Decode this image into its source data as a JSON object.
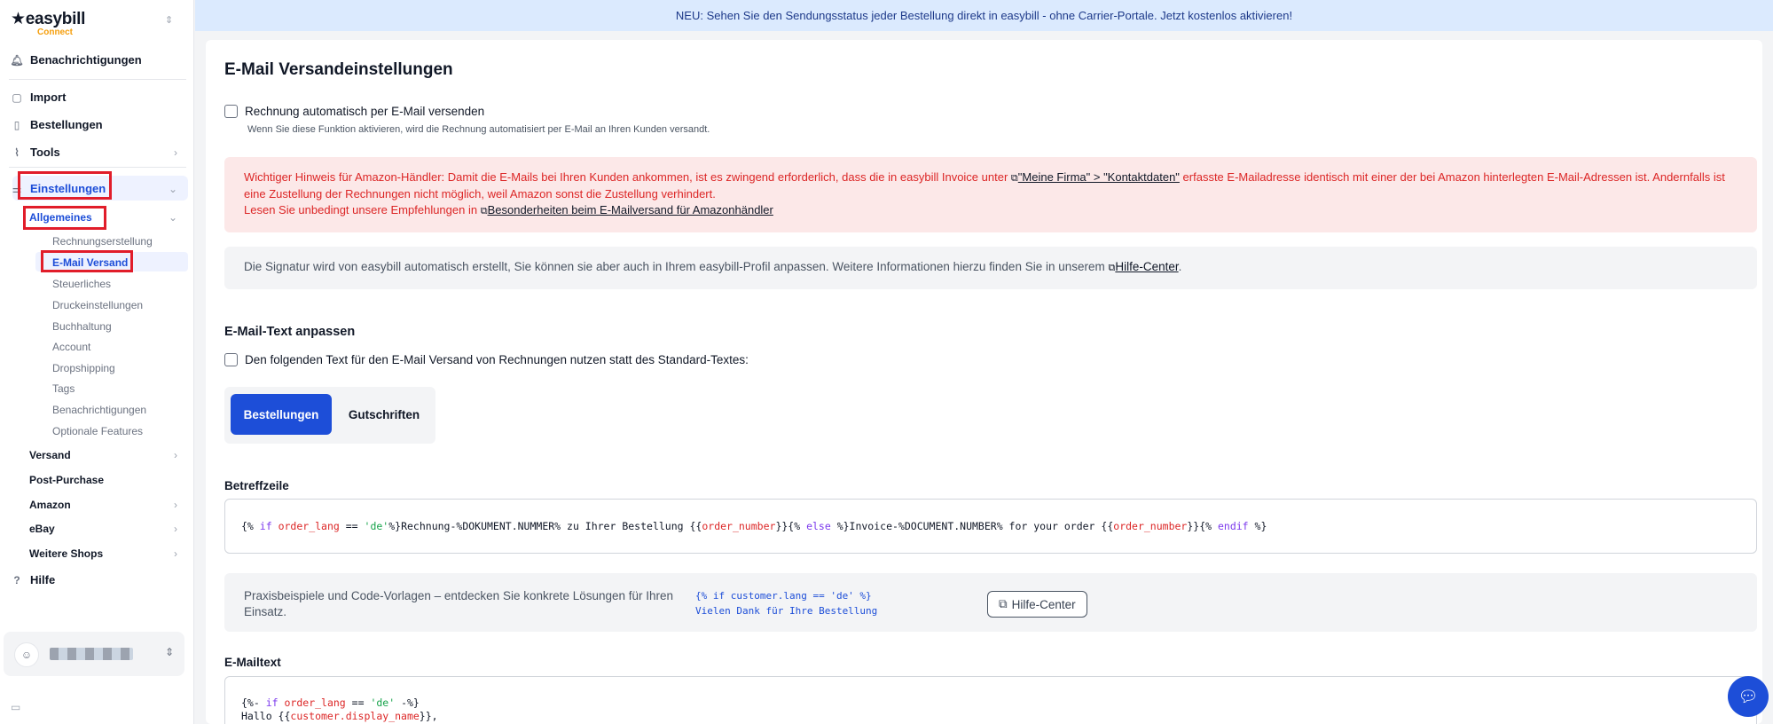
{
  "sidebar": {
    "brand": "easybill",
    "brand_sub": "Connect",
    "items": {
      "notifications": "Benachrichtigungen",
      "import": "Import",
      "orders": "Bestellungen",
      "tools": "Tools",
      "settings": "Einstellungen",
      "general": "Allgemeines",
      "shipping": "Versand",
      "post_purchase": "Post-Purchase",
      "amazon": "Amazon",
      "ebay": "eBay",
      "more_shops": "Weitere Shops",
      "help": "Hilfe"
    },
    "sub_items": [
      "Rechnungserstellung",
      "E-Mail Versand",
      "Steuerliches",
      "Druckeinstellungen",
      "Buchhaltung",
      "Account",
      "Dropshipping",
      "Tags",
      "Benachrichtigungen",
      "Optionale Features"
    ]
  },
  "banner": {
    "text": "NEU: Sehen Sie den Sendungsstatus jeder Bestellung direkt in easybill - ohne Carrier-Portale. Jetzt kostenlos aktivieren!"
  },
  "main": {
    "title": "E-Mail Versandeinstellungen",
    "auto_send_label": "Rechnung automatisch per E-Mail versenden",
    "auto_send_hint": "Wenn Sie diese Funktion aktivieren, wird die Rechnung automatisiert per E-Mail an Ihren Kunden versandt.",
    "alert": {
      "line1_a": "Wichtiger Hinweis für Amazon-Händler: Damit die E-Mails bei Ihren Kunden ankommen, ist es zwingend erforderlich, dass die in easybill Invoice unter",
      "link1": "\"Meine Firma\" > \"Kontaktdaten\"",
      "line1_b": "erfasste E-Mailadresse identisch mit einer der bei Amazon hinterlegten E-Mail-Adressen ist. Andernfalls ist eine Zustellung der Rechnungen nicht möglich, weil Amazon sonst die Zustellung verhindert.",
      "line2_a": "Lesen Sie unbedingt unsere Empfehlungen in",
      "link2": "Besonderheiten beim E-Mailversand für Amazonhändler"
    },
    "info": {
      "text": "Die Signatur wird von easybill automatisch erstellt, Sie können sie aber auch in Ihrem easybill-Profil anpassen. Weitere Informationen hierzu finden Sie in unserem",
      "link": "Hilfe-Center"
    },
    "section_title": "E-Mail-Text anpassen",
    "custom_text_label": "Den folgenden Text für den E-Mail Versand von Rechnungen nutzen statt des Standard-Textes:",
    "tabs": [
      "Bestellungen",
      "Gutschriften"
    ],
    "subject_label": "Betreffzeile",
    "tips": {
      "text": "Praxisbeispiele und Code-Vorlagen – entdecken Sie konkrete Lösungen für Ihren Einsatz.",
      "code_line1": "{% if customer.lang == 'de' %}",
      "code_line2": "Vielen Dank für Ihre Bestellung",
      "button": "Hilfe-Center"
    },
    "mail_label": "E-Mailtext"
  },
  "colors": {
    "primary": "#1d4ed8",
    "alert_bg": "#fce8e8",
    "alert_text": "#dc2626",
    "banner_bg": "#dbeafe",
    "highlight": "#e11d2a"
  }
}
